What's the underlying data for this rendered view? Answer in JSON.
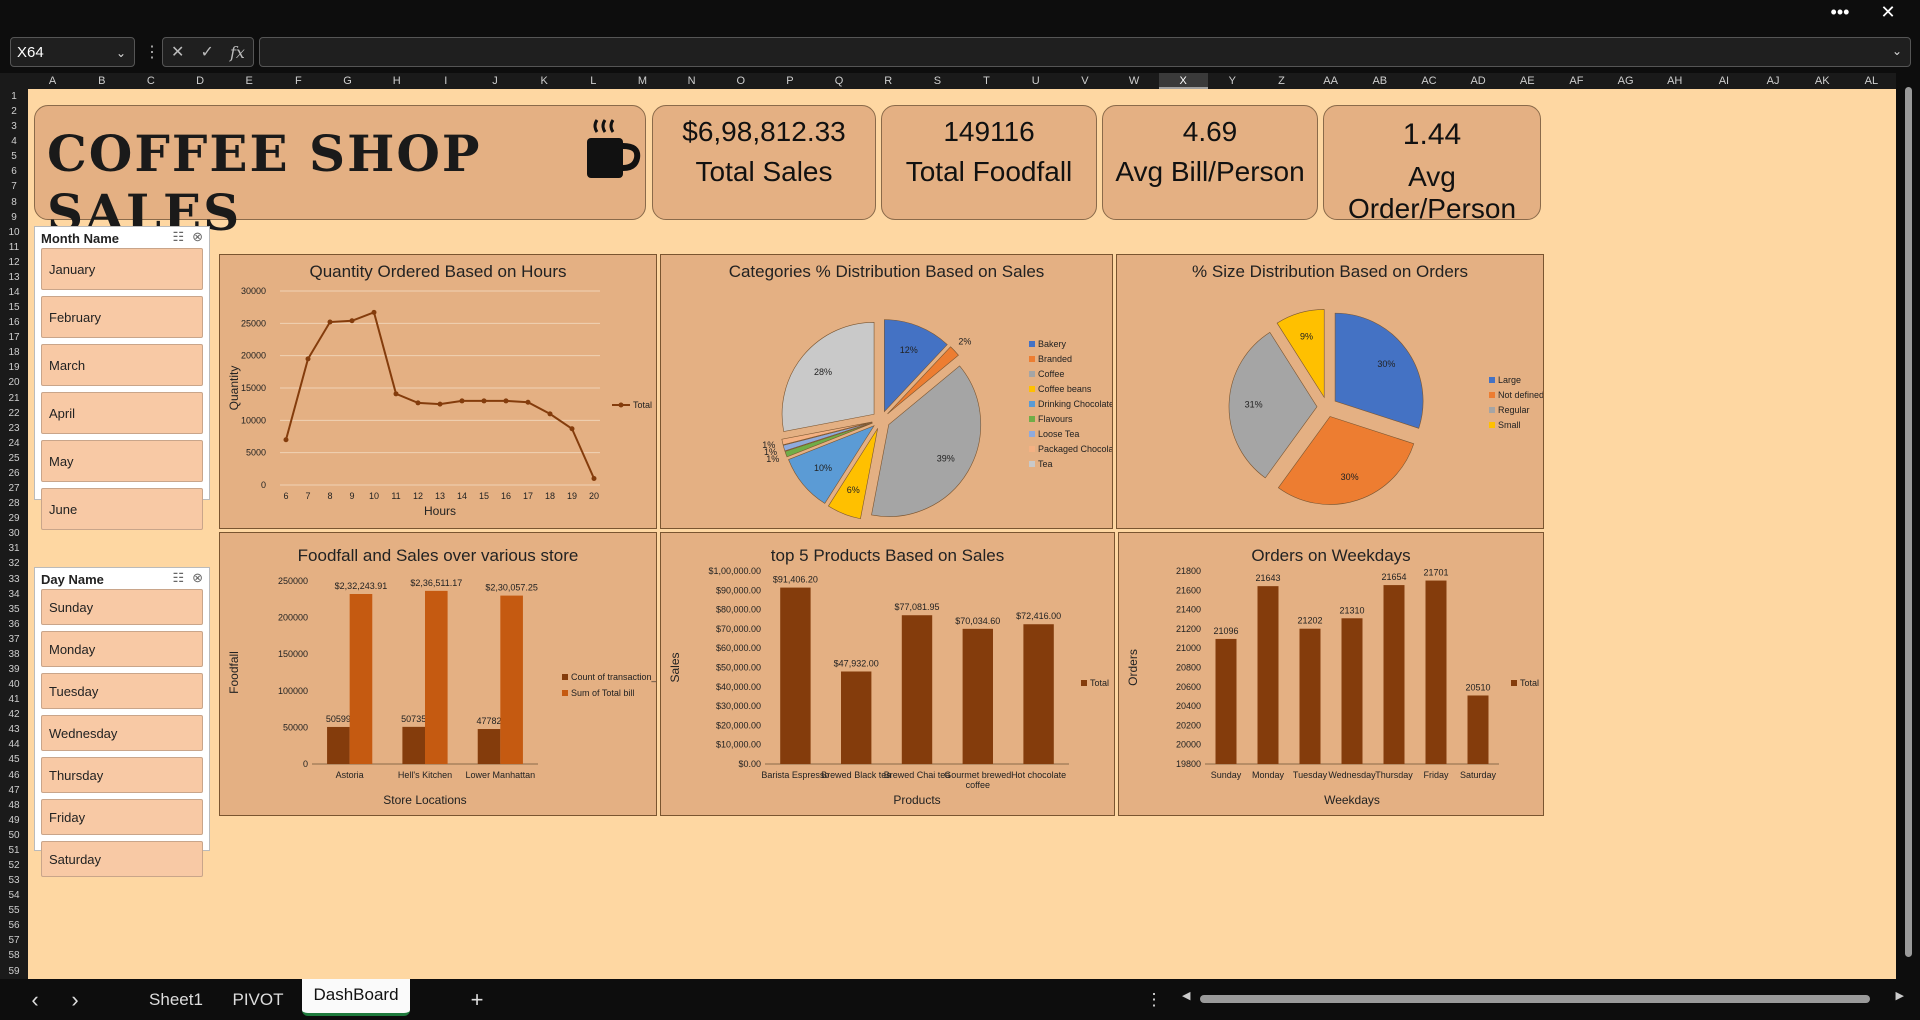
{
  "window": {
    "more_label": "•••",
    "close_label": "✕"
  },
  "formula_bar": {
    "name_box": "X64",
    "formula": "",
    "fx_label": "fx"
  },
  "columns": [
    "A",
    "B",
    "C",
    "D",
    "E",
    "F",
    "G",
    "H",
    "I",
    "J",
    "K",
    "L",
    "M",
    "N",
    "O",
    "P",
    "Q",
    "R",
    "S",
    "T",
    "U",
    "V",
    "W",
    "X",
    "Y",
    "Z",
    "AA",
    "AB",
    "AC",
    "AD",
    "AE",
    "AF",
    "AG",
    "AH",
    "AI",
    "AJ",
    "AK",
    "AL"
  ],
  "selected_column": "X",
  "rows": [
    "1",
    "2",
    "3",
    "4",
    "5",
    "6",
    "7",
    "8",
    "9",
    "10",
    "11",
    "12",
    "13",
    "14",
    "15",
    "16",
    "17",
    "18",
    "19",
    "20",
    "21",
    "22",
    "23",
    "24",
    "25",
    "26",
    "27",
    "28",
    "29",
    "30",
    "31",
    "32",
    "33",
    "34",
    "35",
    "36",
    "37",
    "38",
    "39",
    "40",
    "41",
    "42",
    "43",
    "44",
    "45",
    "46",
    "47",
    "48",
    "49",
    "50",
    "51",
    "52",
    "53",
    "54",
    "55",
    "56",
    "57",
    "58",
    "59"
  ],
  "dashboard": {
    "title": "COFFEE SHOP SALES",
    "icon": "coffee-cup-icon",
    "kpis": [
      {
        "value": "$6,98,812.33",
        "label": "Total Sales"
      },
      {
        "value": "149116",
        "label": "Total Foodfall"
      },
      {
        "value": "4.69",
        "label": "Avg Bill/Person"
      },
      {
        "value": "1.44",
        "label": "Avg Order/Person"
      }
    ]
  },
  "slicers": {
    "month": {
      "header": "Month Name",
      "items": [
        "January",
        "February",
        "March",
        "April",
        "May",
        "June"
      ]
    },
    "day": {
      "header": "Day Name",
      "items": [
        "Sunday",
        "Monday",
        "Tuesday",
        "Wednesday",
        "Thursday",
        "Friday",
        "Saturday"
      ]
    }
  },
  "chart_data": [
    {
      "type": "line",
      "title": "Quantity Ordered Based on Hours",
      "xlabel": "Hours",
      "ylabel": "Quantity",
      "x": [
        6,
        7,
        8,
        9,
        10,
        11,
        12,
        13,
        14,
        15,
        16,
        17,
        18,
        19,
        20
      ],
      "series": [
        {
          "name": "Total",
          "values": [
            7000,
            19500,
            25200,
            25400,
            26700,
            14100,
            12700,
            12500,
            13000,
            13000,
            13000,
            12800,
            11000,
            8700,
            1000
          ]
        }
      ],
      "ylim": [
        0,
        30000
      ],
      "yticks": [
        0,
        5000,
        10000,
        15000,
        20000,
        25000,
        30000
      ],
      "grid": true,
      "legend": "right",
      "color": "#843c0c"
    },
    {
      "type": "pie",
      "title": "Categories % Distribution Based on Sales",
      "categories": [
        "Bakery",
        "Branded",
        "Coffee",
        "Coffee beans",
        "Drinking Chocolate",
        "Flavours",
        "Loose Tea",
        "Packaged Chocolate",
        "Tea"
      ],
      "values": [
        12,
        2,
        39,
        6,
        10,
        1,
        1,
        1,
        28
      ],
      "labels": [
        "12%",
        "2%",
        "39%",
        "6%",
        "10%",
        "1%",
        "1%",
        "1%",
        "28%"
      ],
      "colors": [
        "#4472c4",
        "#ed7d31",
        "#a5a5a5",
        "#ffc000",
        "#5b9bd5",
        "#70ad47",
        "#8faadc",
        "#f4b183",
        "#c9c9c9"
      ],
      "legend": "right"
    },
    {
      "type": "pie",
      "title": "% Size Distribution Based on Orders",
      "categories": [
        "Large",
        "Not defined",
        "Regular",
        "Small"
      ],
      "values": [
        30,
        30,
        31,
        9
      ],
      "labels": [
        "30%",
        "30%",
        "31%",
        "9%"
      ],
      "colors": [
        "#4472c4",
        "#ed7d31",
        "#a5a5a5",
        "#ffc000"
      ],
      "legend": "right"
    },
    {
      "type": "bar",
      "title": "Foodfall and Sales over various store",
      "xlabel": "Store Locations",
      "ylabel": "Foodfall",
      "categories": [
        "Astoria",
        "Hell's Kitchen",
        "Lower Manhattan"
      ],
      "series": [
        {
          "name": "Count of transaction_id",
          "values": [
            50599,
            50735,
            47782
          ],
          "labels": [
            "50599",
            "50735",
            "47782"
          ],
          "color": "#843c0c"
        },
        {
          "name": "Sum of Total bill",
          "values": [
            232243.91,
            236511.17,
            230057.25
          ],
          "labels": [
            "$2,32,243.91",
            "$2,36,511.17",
            "$2,30,057.25"
          ],
          "color": "#c55a11"
        }
      ],
      "ylim": [
        0,
        250000
      ],
      "yticks": [
        0,
        50000,
        100000,
        150000,
        200000,
        250000
      ],
      "legend": "right"
    },
    {
      "type": "bar",
      "title": "top 5 Products Based on Sales",
      "xlabel": "Products",
      "ylabel": "Sales",
      "categories": [
        "Barista Espresso",
        "Brewed Black tea",
        "Brewed Chai tea",
        "Gourmet brewed coffee",
        "Hot chocolate"
      ],
      "series": [
        {
          "name": "Total",
          "values": [
            91406.2,
            47932.0,
            77081.95,
            70034.6,
            72416.0
          ],
          "labels": [
            "$91,406.20",
            "$47,932.00",
            "$77,081.95",
            "$70,034.60",
            "$72,416.00"
          ],
          "color": "#843c0c"
        }
      ],
      "ylim": [
        0,
        100000
      ],
      "yticks": [
        0,
        10000,
        20000,
        30000,
        40000,
        50000,
        60000,
        70000,
        80000,
        90000,
        100000
      ],
      "ytick_labels": [
        "$0.00",
        "$10,000.00",
        "$20,000.00",
        "$30,000.00",
        "$40,000.00",
        "$50,000.00",
        "$60,000.00",
        "$70,000.00",
        "$80,000.00",
        "$90,000.00",
        "$1,00,000.00"
      ],
      "legend": "right"
    },
    {
      "type": "bar",
      "title": "Orders on Weekdays",
      "xlabel": "Weekdays",
      "ylabel": "Orders",
      "categories": [
        "Sunday",
        "Monday",
        "Tuesday",
        "Wednesday",
        "Thursday",
        "Friday",
        "Saturday"
      ],
      "series": [
        {
          "name": "Total",
          "values": [
            21096,
            21643,
            21202,
            21310,
            21654,
            21701,
            20510
          ],
          "labels": [
            "21096",
            "21643",
            "21202",
            "21310",
            "21654",
            "21701",
            "20510"
          ],
          "color": "#843c0c"
        }
      ],
      "ylim": [
        19800,
        21800
      ],
      "yticks": [
        19800,
        20000,
        20200,
        20400,
        20600,
        20800,
        21000,
        21200,
        21400,
        21600,
        21800
      ],
      "legend": "right"
    }
  ],
  "tabs": {
    "sheets": [
      "Sheet1",
      "PIVOT",
      "DashBoard"
    ],
    "active": "DashBoard",
    "add_label": "+",
    "prev": "‹",
    "next": "›",
    "menu": "⋮"
  }
}
